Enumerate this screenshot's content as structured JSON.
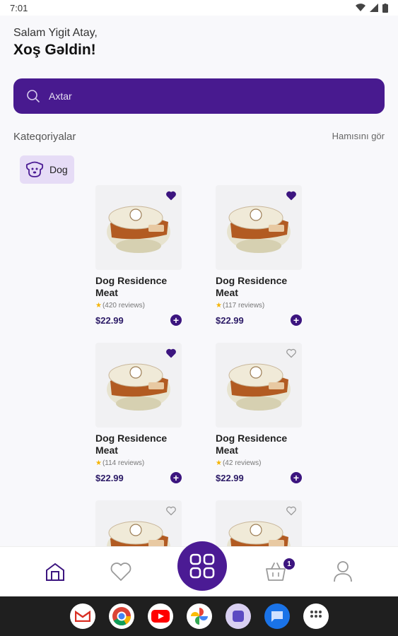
{
  "status_bar": {
    "time": "7:01"
  },
  "header": {
    "greeting": "Salam Yigit Atay,",
    "welcome": "Xoş Gəldin!"
  },
  "search": {
    "placeholder": "Axtar"
  },
  "categories": {
    "title": "Kateqoriyalar",
    "see_all": "Hamısını gör",
    "items": [
      {
        "label": "Dog",
        "icon": "dog-icon"
      }
    ]
  },
  "products": [
    {
      "name": "Dog Residence Meat",
      "reviews": "(420 reviews)",
      "price": "$22.99",
      "favorite": true
    },
    {
      "name": "Dog Residence Meat",
      "reviews": "(117 reviews)",
      "price": "$22.99",
      "favorite": true
    },
    {
      "name": "Dog Residence Meat",
      "reviews": "(114 reviews)",
      "price": "$22.99",
      "favorite": true
    },
    {
      "name": "Dog Residence Meat",
      "reviews": "(42 reviews)",
      "price": "$22.99",
      "favorite": false
    },
    {
      "favorite": false
    },
    {
      "favorite": false
    }
  ],
  "bottom_nav": {
    "items": [
      "home-icon",
      "heart-icon",
      "grid-icon",
      "basket-icon",
      "profile-icon"
    ],
    "cart_badge": "1"
  },
  "dock": {
    "apps": [
      "gmail-icon",
      "chrome-icon",
      "youtube-icon",
      "photos-icon",
      "app-icon",
      "messages-icon",
      "apps-grid-icon"
    ]
  },
  "colors": {
    "primary": "#481a8f",
    "chip_bg": "#e6dcf6",
    "star": "#f5b400"
  }
}
